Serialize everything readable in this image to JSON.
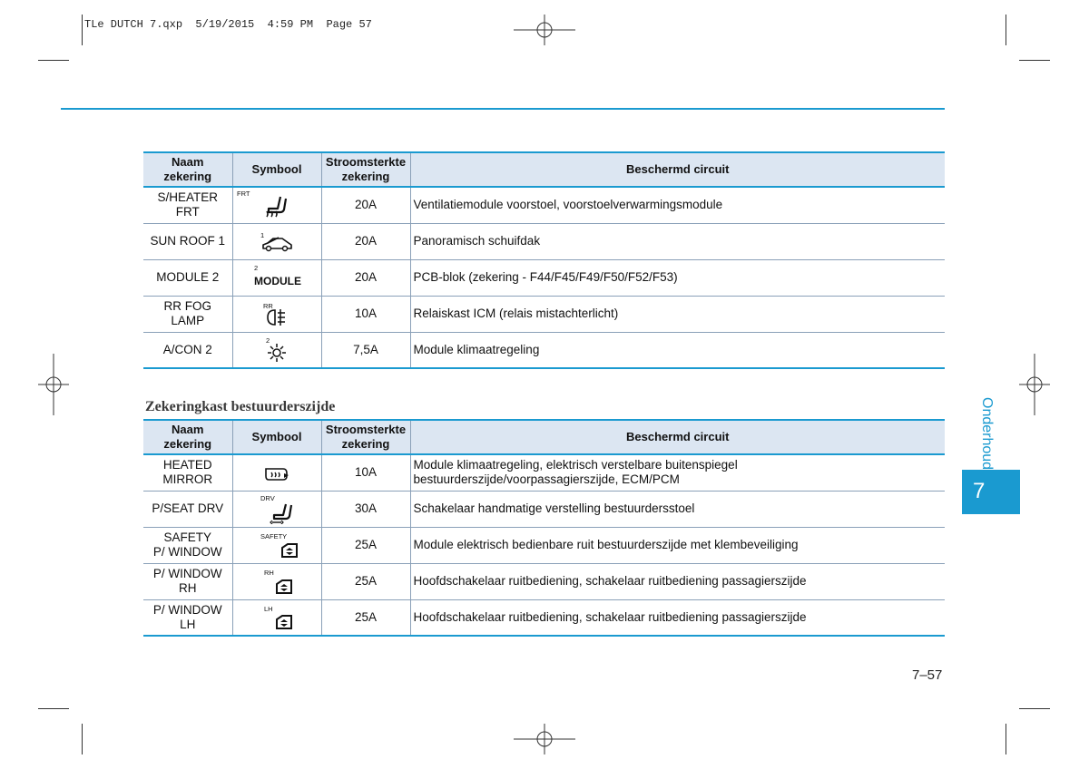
{
  "print_header": "TLe DUTCH 7.qxp  5/19/2015  4:59 PM  Page 57",
  "table1": {
    "headers": [
      "Naam zekering",
      "Symbool",
      "Stroomsterkte\nzekering",
      "Beschermd circuit"
    ],
    "rows": [
      {
        "name": "S/HEATER\nFRT",
        "symbol_label": "FRT",
        "symbol_icon": "seat-heater-icon",
        "amp": "20A",
        "circuit": "Ventilatiemodule voorstoel, voorstoelverwarmingsmodule"
      },
      {
        "name": "SUN ROOF 1",
        "symbol_label": "1",
        "symbol_icon": "sunroof-icon",
        "amp": "20A",
        "circuit": "Panoramisch schuifdak"
      },
      {
        "name": "MODULE 2",
        "symbol_label": "2",
        "symbol_text": "MODULE",
        "amp": "20A",
        "circuit": "PCB-blok (zekering - F44/F45/F49/F50/F52/F53)"
      },
      {
        "name": "RR FOG\nLAMP",
        "symbol_label": "RR",
        "symbol_icon": "rear-fog-lamp-icon",
        "amp": "10A",
        "circuit": "Relaiskast ICM (relais mistachterlicht)"
      },
      {
        "name": "A/CON 2",
        "symbol_label": "2",
        "symbol_icon": "air-conditioning-icon",
        "amp": "7,5A",
        "circuit": "Module klimaatregeling"
      }
    ]
  },
  "section_title": "Zekeringkast bestuurderszijde",
  "table2": {
    "headers": [
      "Naam zekering",
      "Symbool",
      "Stroomsterkte\nzekering",
      "Beschermd circuit"
    ],
    "rows": [
      {
        "name": "HEATED\nMIRROR",
        "symbol_label": "",
        "symbol_icon": "heated-mirror-icon",
        "amp": "10A",
        "circuit": "Module klimaatregeling, elektrisch verstelbare buitenspiegel\nbestuurderszijde/voorpassagierszijde, ECM/PCM"
      },
      {
        "name": "P/SEAT DRV",
        "symbol_label": "DRV",
        "symbol_icon": "power-seat-icon",
        "amp": "30A",
        "circuit": "Schakelaar handmatige verstelling bestuurdersstoel"
      },
      {
        "name": "SAFETY\nP/ WINDOW",
        "symbol_label": "SAFETY",
        "symbol_icon": "power-window-icon",
        "amp": "25A",
        "circuit": "Module elektrisch bedienbare ruit bestuurderszijde met klembeveiliging"
      },
      {
        "name": "P/ WINDOW\nRH",
        "symbol_label": "RH",
        "symbol_icon": "power-window-icon",
        "amp": "25A",
        "circuit": "Hoofdschakelaar ruitbediening, schakelaar ruitbediening passagierszijde"
      },
      {
        "name": "P/ WINDOW\nLH",
        "symbol_label": "LH",
        "symbol_icon": "power-window-icon",
        "amp": "25A",
        "circuit": "Hoofdschakelaar ruitbediening, schakelaar ruitbediening passagierszijde"
      }
    ]
  },
  "side_label": "Onderhoud",
  "chapter_number": "7",
  "page_number": "7–57",
  "colors": {
    "accent": "#1a9ad0",
    "header_bg": "#dce6f2"
  }
}
